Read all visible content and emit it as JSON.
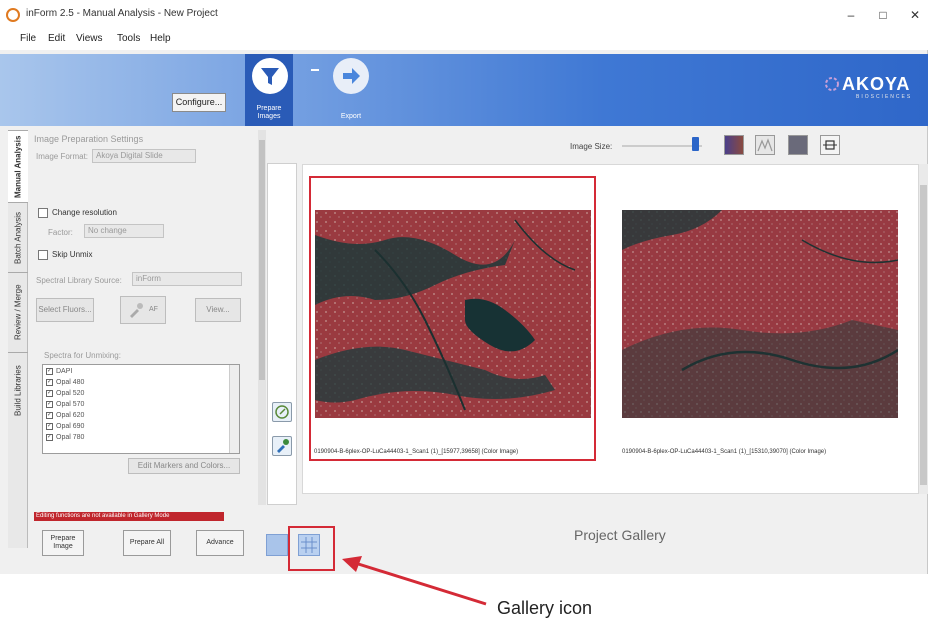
{
  "window": {
    "title": "inForm 2.5 - Manual Analysis - New Project",
    "controls": {
      "minimize": "–",
      "maximize": "□",
      "close": "✕"
    }
  },
  "menu": [
    "File",
    "Edit",
    "Views",
    "Tools",
    "Help"
  ],
  "toolbar": {
    "configure_label": "Configure...",
    "steps": [
      {
        "label_line1": "Prepare",
        "label_line2": "Images",
        "icon": "funnel-icon",
        "active": true
      },
      {
        "label_line1": "Export",
        "label_line2": "",
        "icon": "arrow-right-icon",
        "active": false
      }
    ],
    "logo": {
      "main": "AKOYA",
      "sub": "BIOSCIENCES"
    }
  },
  "side_tabs": [
    "Manual Analysis",
    "Batch Analysis",
    "Review / Merge",
    "Build Libraries"
  ],
  "settings": {
    "heading": "Image Preparation Settings",
    "image_format_label": "Image Format:",
    "image_format_value": "Akoya Digital Slide",
    "change_resolution_label": "Change resolution",
    "factor_label": "Factor:",
    "factor_value": "No change",
    "skip_unmix_label": "Skip Unmix",
    "spectral_library_label": "Spectral Library Source:",
    "spectral_library_value": "inForm",
    "select_fluors_label": "Select Fluors...",
    "af_label": "AF",
    "view_label": "View...",
    "spectra_heading": "Spectra for Unmixing:",
    "spectra": [
      "DAPI",
      "Opal 480",
      "Opal 520",
      "Opal 570",
      "Opal 620",
      "Opal 690",
      "Opal 780"
    ],
    "edit_markers_label": "Edit Markers and Colors...",
    "warning": "Editing functions are not available in Gallery Mode",
    "prepare_image_line1": "Prepare",
    "prepare_image_line2": "Image",
    "prepare_all_label": "Prepare All",
    "advance_label": "Advance"
  },
  "gallery": {
    "image_size_label": "Image Size:",
    "image_size_level": 0.88,
    "view_icons": [
      "composite-view-icon",
      "spectra-view-icon",
      "component-view-icon",
      "pixel-view-icon"
    ],
    "items": [
      {
        "caption": "0190904-B-6plex-OP-LuCa44403-1_Scan1 (1)_[15977,39658] (Color Image)",
        "selected": true
      },
      {
        "caption": "0190904-B-6plex-OP-LuCa44403-1_Scan1 (1)_[15310,39070] (Color Image)",
        "selected": false
      }
    ],
    "title": "Project Gallery"
  },
  "annotation": {
    "label": "Gallery icon",
    "color": "#d42a36"
  },
  "colors": {
    "banner_dark": "#2f67c9",
    "warning_red": "#c0262d",
    "tissue": "#9a3a40"
  }
}
